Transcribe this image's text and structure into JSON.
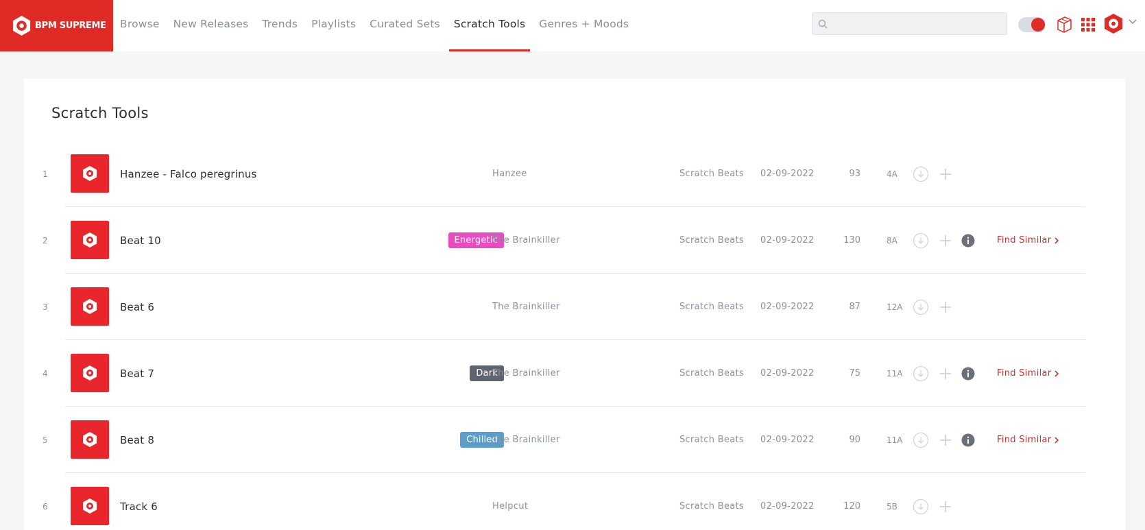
{
  "header": {
    "logo_text": "BPM SUPREME",
    "nav": [
      {
        "label": "Browse",
        "active": false
      },
      {
        "label": "New Releases",
        "active": false
      },
      {
        "label": "Trends",
        "active": false
      },
      {
        "label": "Playlists",
        "active": false
      },
      {
        "label": "Curated Sets",
        "active": false
      },
      {
        "label": "Scratch Tools",
        "active": true
      },
      {
        "label": "Genres + Moods",
        "active": false
      }
    ],
    "search": {
      "value": "",
      "placeholder": ""
    },
    "icons": [
      "search-icon",
      "theme-toggle",
      "crate-icon",
      "apps-grid-icon",
      "account-avatar-icon",
      "chevron-down-icon"
    ]
  },
  "page": {
    "title": "Scratch Tools"
  },
  "colors": {
    "brand": "#e02a25",
    "tag_energetic": "#e94cc1",
    "tag_dark": "#5e6470",
    "tag_chilled": "#5d9ec9"
  },
  "tracks": [
    {
      "num": "1",
      "title": "Hanzee - Falco peregrinus",
      "tag": "",
      "tag_color": "",
      "artist": "Hanzee",
      "genre": "Scratch Beats",
      "date": "02-09-2022",
      "bpm": "93",
      "key": "4A",
      "has_info": false,
      "find_similar": ""
    },
    {
      "num": "2",
      "title": "Beat 10",
      "tag": "Energetic",
      "tag_color": "#e94cc1",
      "artist": "The Brainkiller",
      "genre": "Scratch Beats",
      "date": "02-09-2022",
      "bpm": "130",
      "key": "8A",
      "has_info": true,
      "find_similar": "Find Similar"
    },
    {
      "num": "3",
      "title": "Beat 6",
      "tag": "",
      "tag_color": "",
      "artist": "The Brainkiller",
      "genre": "Scratch Beats",
      "date": "02-09-2022",
      "bpm": "87",
      "key": "12A",
      "has_info": false,
      "find_similar": ""
    },
    {
      "num": "4",
      "title": "Beat 7",
      "tag": "Dark",
      "tag_color": "#5e6470",
      "artist": "The Brainkiller",
      "genre": "Scratch Beats",
      "date": "02-09-2022",
      "bpm": "75",
      "key": "11A",
      "has_info": true,
      "find_similar": "Find Similar"
    },
    {
      "num": "5",
      "title": "Beat 8",
      "tag": "Chilled",
      "tag_color": "#5d9ec9",
      "artist": "The Brainkiller",
      "genre": "Scratch Beats",
      "date": "02-09-2022",
      "bpm": "90",
      "key": "11A",
      "has_info": true,
      "find_similar": "Find Similar"
    },
    {
      "num": "6",
      "title": "Track 6",
      "tag": "",
      "tag_color": "",
      "artist": "Helpcut",
      "genre": "Scratch Beats",
      "date": "02-09-2022",
      "bpm": "120",
      "key": "5B",
      "has_info": false,
      "find_similar": ""
    }
  ]
}
